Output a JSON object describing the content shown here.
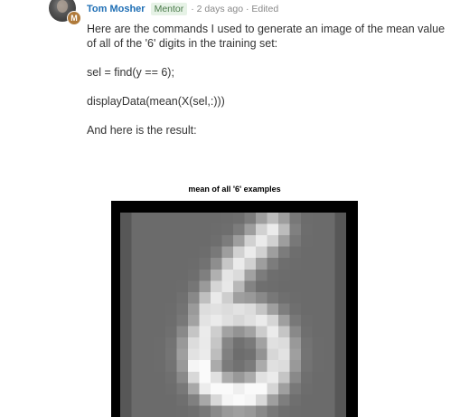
{
  "post": {
    "author": "Tom Mosher",
    "role": "Mentor",
    "role_badge_letter": "M",
    "time": "· 2 days ago · Edited",
    "paragraphs": [
      "Here are the commands I used to generate an image of the mean value of all of the '6' digits in the training set:",
      "sel = find(y == 6);",
      "displayData(mean(X(sel,:)))",
      "And here is the result:"
    ]
  },
  "figure": {
    "title": "mean of all '6' examples"
  }
}
